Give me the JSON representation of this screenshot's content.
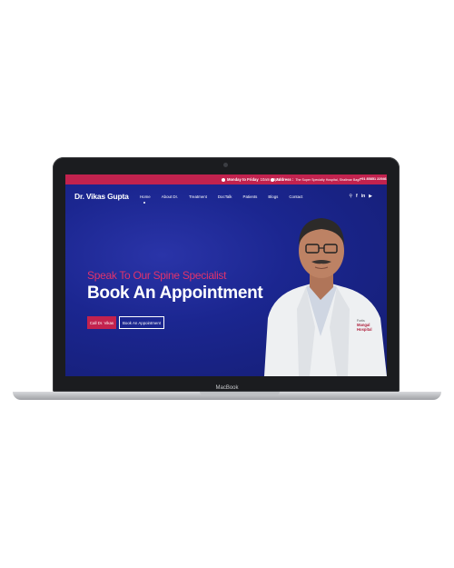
{
  "device": {
    "label": "MacBook"
  },
  "topbar": {
    "hours_label": "Monday to Friday",
    "hours_value": "10am - 6pm",
    "address_label": "Address :",
    "address_value": "The Super Specialty Hospital, Shalimar Bagh",
    "phone": "+91 85851 22946"
  },
  "nav": {
    "brand": "Dr. Vikas Gupta",
    "items": [
      "Home",
      "About Dr.",
      "Treatment",
      "DocTalk",
      "Patients",
      "Blogs",
      "Contact"
    ]
  },
  "hero": {
    "subtitle": "Speak To Our Spine Specialist",
    "title": "Book An Appointment",
    "call_button": "Call Dr. Vikas",
    "book_button": "Book An Appointment"
  },
  "coat_logo": {
    "line1": "Fortis",
    "line2": "Mangal",
    "line3": "Hospital"
  },
  "colors": {
    "accent": "#c2224e",
    "hero_bg": "#1b2690"
  },
  "icons": [
    "clock-icon",
    "location-icon",
    "search-icon",
    "facebook-icon",
    "linkedin-icon",
    "youtube-icon"
  ]
}
